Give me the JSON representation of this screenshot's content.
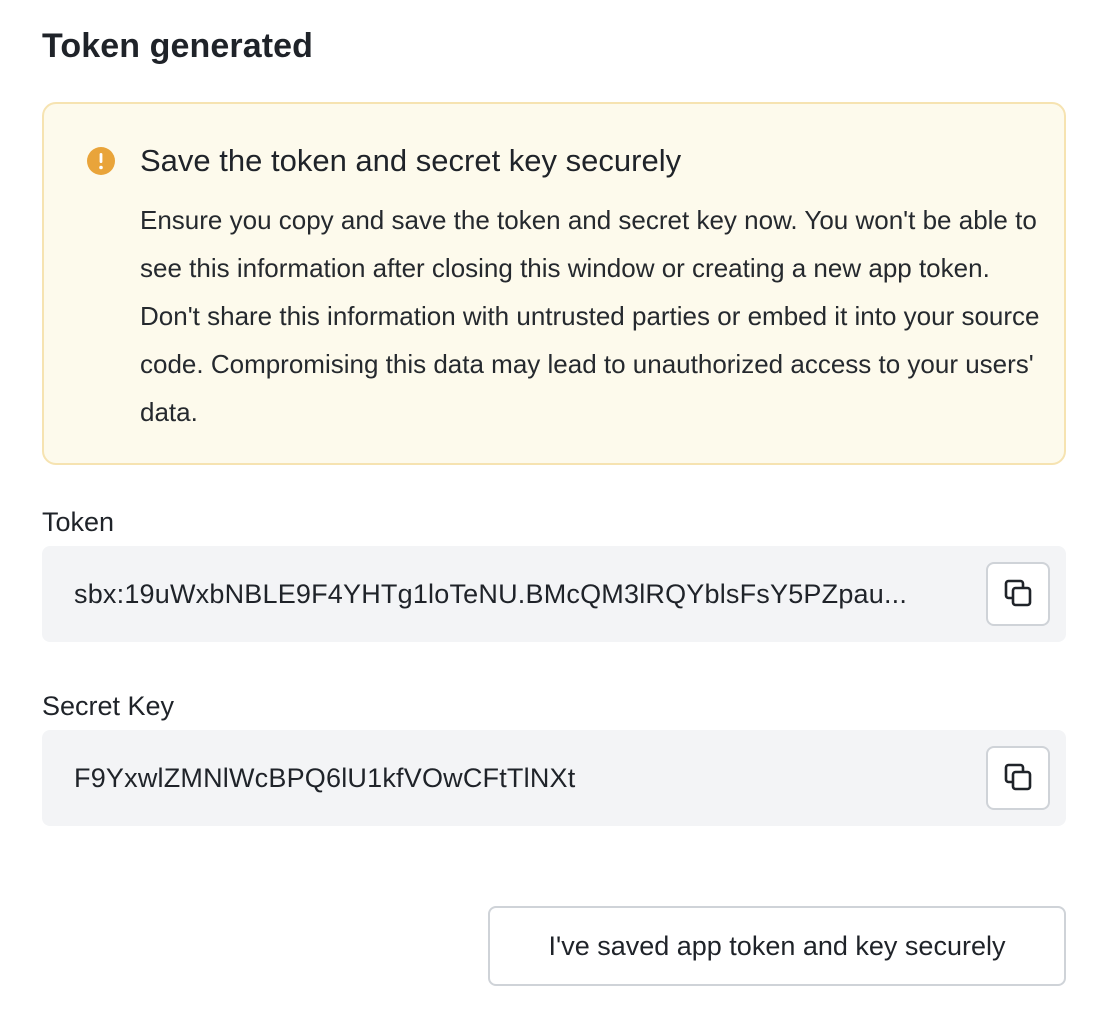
{
  "dialog": {
    "title": "Token generated"
  },
  "alert": {
    "icon": "exclamation-circle-icon",
    "icon_color": "#e9a43a",
    "background_color": "#fdfaec",
    "border_color": "#f6e3b1",
    "title": "Save the token and secret key securely",
    "body": "Ensure you copy and save the token and secret key now. You won't be able to see this information after closing this window or creating a new app token. Don't share this information with untrusted parties or embed it into your source code. Compromising this data may lead to unauthorized access to your users' data."
  },
  "fields": {
    "token": {
      "label": "Token",
      "value": "sbx:19uWxbNBLE9F4YHTg1loTeNU.BMcQM3lRQYblsFsY5PZpau...",
      "copy_icon": "copy-icon"
    },
    "secret_key": {
      "label": "Secret Key",
      "value": "F9YxwlZMNlWcBPQ6lU1kfVOwCFtTlNXt",
      "copy_icon": "copy-icon"
    }
  },
  "actions": {
    "confirm_label": "I've saved app token and key securely"
  }
}
